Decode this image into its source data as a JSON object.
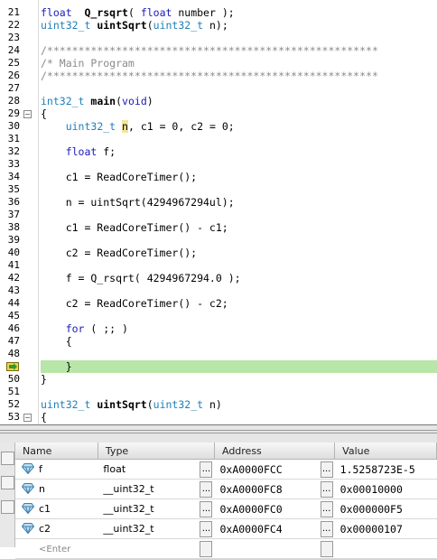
{
  "editor": {
    "lines": [
      {
        "n": "21",
        "parts": [
          [
            "kw",
            "float"
          ],
          [
            "",
            "  "
          ],
          [
            "fn",
            "Q_rsqrt"
          ],
          [
            "",
            "( "
          ],
          [
            "kw",
            "float"
          ],
          [
            "",
            " number );"
          ]
        ]
      },
      {
        "n": "22",
        "parts": [
          [
            "ty",
            "uint32_t"
          ],
          [
            "",
            " "
          ],
          [
            "fn",
            "uintSqrt"
          ],
          [
            "",
            "("
          ],
          [
            "ty",
            "uint32_t"
          ],
          [
            "",
            " n);"
          ]
        ]
      },
      {
        "n": "23",
        "parts": []
      },
      {
        "n": "24",
        "parts": [
          [
            "cm",
            "/*****************************************************"
          ]
        ]
      },
      {
        "n": "25",
        "parts": [
          [
            "cm",
            "/* Main Program"
          ]
        ]
      },
      {
        "n": "26",
        "parts": [
          [
            "cm",
            "/*****************************************************"
          ]
        ]
      },
      {
        "n": "27",
        "parts": []
      },
      {
        "n": "28",
        "parts": [
          [
            "ty",
            "int32_t"
          ],
          [
            "",
            " "
          ],
          [
            "fn",
            "main"
          ],
          [
            "",
            "("
          ],
          [
            "kw",
            "void"
          ],
          [
            "",
            ")"
          ]
        ]
      },
      {
        "n": "29",
        "fold": "−",
        "parts": [
          [
            "",
            "{"
          ]
        ]
      },
      {
        "n": "30",
        "parts": [
          [
            "",
            "    "
          ],
          [
            "ty",
            "uint32_t"
          ],
          [
            "",
            " "
          ],
          [
            "hl",
            "n"
          ],
          [
            "",
            ", c1 = 0, c2 = 0;"
          ]
        ]
      },
      {
        "n": "31",
        "parts": []
      },
      {
        "n": "32",
        "parts": [
          [
            "",
            "    "
          ],
          [
            "kw",
            "float"
          ],
          [
            "",
            " f;"
          ]
        ]
      },
      {
        "n": "33",
        "parts": []
      },
      {
        "n": "34",
        "parts": [
          [
            "",
            "    c1 = ReadCoreTimer();"
          ]
        ]
      },
      {
        "n": "35",
        "parts": []
      },
      {
        "n": "36",
        "parts": [
          [
            "",
            "    n = uintSqrt(4294967294ul);"
          ]
        ]
      },
      {
        "n": "37",
        "parts": []
      },
      {
        "n": "38",
        "parts": [
          [
            "",
            "    c1 = ReadCoreTimer() - c1;"
          ]
        ]
      },
      {
        "n": "39",
        "parts": []
      },
      {
        "n": "40",
        "parts": [
          [
            "",
            "    c2 = ReadCoreTimer();"
          ]
        ]
      },
      {
        "n": "41",
        "parts": []
      },
      {
        "n": "42",
        "parts": [
          [
            "",
            "    f = Q_rsqrt( 4294967294.0 );"
          ]
        ]
      },
      {
        "n": "43",
        "parts": []
      },
      {
        "n": "44",
        "parts": [
          [
            "",
            "    c2 = ReadCoreTimer() - c2;"
          ]
        ]
      },
      {
        "n": "45",
        "parts": []
      },
      {
        "n": "46",
        "parts": [
          [
            "",
            "    "
          ],
          [
            "kw",
            "for"
          ],
          [
            "",
            " ( ;; )"
          ]
        ]
      },
      {
        "n": "47",
        "parts": [
          [
            "",
            "    {"
          ]
        ]
      },
      {
        "n": "48",
        "parts": []
      },
      {
        "n": "",
        "pc": true,
        "parts": [
          [
            "",
            "    }"
          ]
        ]
      },
      {
        "n": "50",
        "parts": [
          [
            "",
            "}"
          ]
        ]
      },
      {
        "n": "51",
        "parts": []
      },
      {
        "n": "52",
        "parts": [
          [
            "ty",
            "uint32_t"
          ],
          [
            "",
            " "
          ],
          [
            "fn",
            "uintSqrt"
          ],
          [
            "",
            "("
          ],
          [
            "ty",
            "uint32_t"
          ],
          [
            "",
            " n)"
          ]
        ]
      },
      {
        "n": "53",
        "fold": "−",
        "parts": [
          [
            "",
            "{"
          ]
        ]
      }
    ]
  },
  "watches": {
    "headers": {
      "name": "Name",
      "type": "Type",
      "address": "Address",
      "value": "Value"
    },
    "rows": [
      {
        "name": "f",
        "type": "float",
        "address": "0xA0000FCC",
        "value": "1.5258723E-5"
      },
      {
        "name": "n",
        "type": "__uint32_t",
        "address": "0xA0000FC8",
        "value": "0x00010000"
      },
      {
        "name": "c1",
        "type": "__uint32_t",
        "address": "0xA0000FC0",
        "value": "0x000000F5"
      },
      {
        "name": "c2",
        "type": "__uint32_t",
        "address": "0xA0000FC4",
        "value": "0x00000107"
      }
    ],
    "dots_label": "...",
    "enter_label": "<Enter"
  },
  "colors": {
    "pc_highlight": "#b8e6a8",
    "keyword": "#1a1ab8",
    "type": "#1f7fb8",
    "comment": "#8a8a8a"
  },
  "icons": {
    "pc": "program-counter-arrow-icon",
    "watch": "watch-variable-icon"
  }
}
